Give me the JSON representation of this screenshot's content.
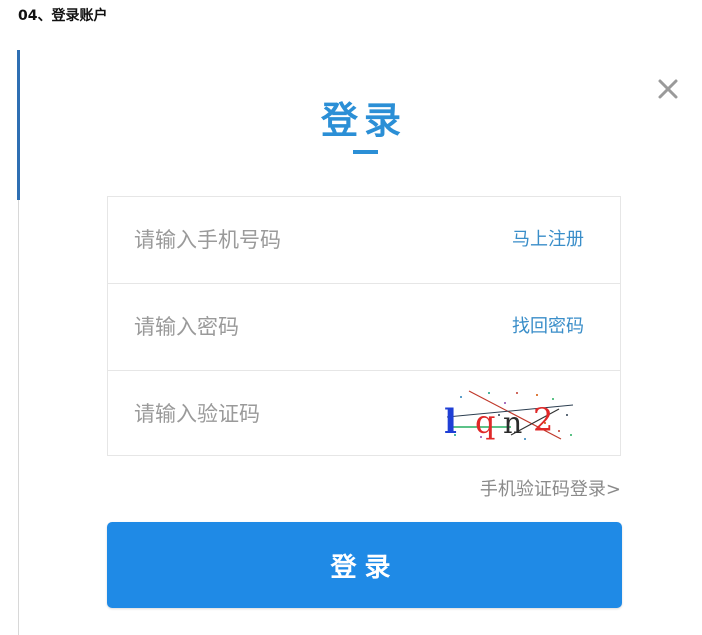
{
  "step_title": "04、登录账户",
  "dialog": {
    "title": "登录",
    "close_icon": "close-icon",
    "fields": {
      "phone": {
        "placeholder": "请输入手机号码",
        "value": "",
        "link": "马上注册"
      },
      "password": {
        "placeholder": "请输入密码",
        "value": "",
        "link": "找回密码"
      },
      "captcha": {
        "placeholder": "请输入验证码",
        "value": "",
        "captcha_text": "lqn2"
      }
    },
    "sms_login_link": "手机验证码登录>",
    "submit_label": "登录"
  },
  "colors": {
    "accent": "#2b8fd6",
    "button": "#1f8ae6",
    "link": "#3a8ec9",
    "muted": "#8a8a8a"
  }
}
